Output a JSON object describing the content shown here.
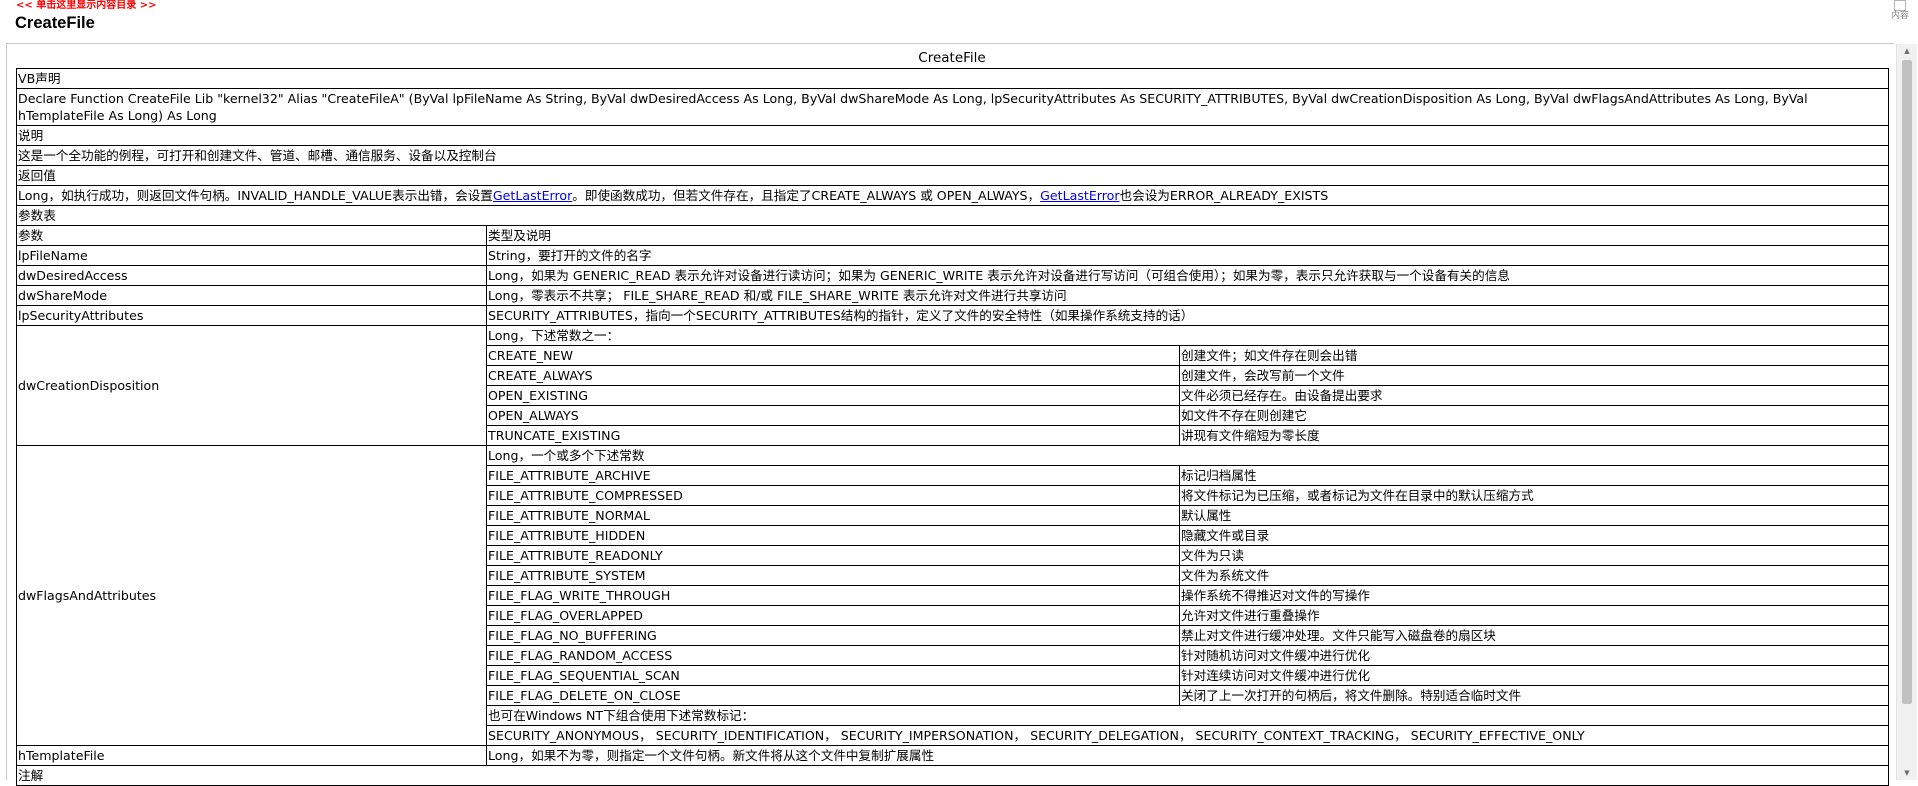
{
  "header": {
    "toc_link": "<< 单击这里显示内容目录 >>",
    "title": "CreateFile",
    "content_button": "内容"
  },
  "doc": {
    "title": "CreateFile",
    "vb_header": "VB声明",
    "vb_declare": "Declare Function CreateFile Lib \"kernel32\" Alias \"CreateFileA\" (ByVal lpFileName As String, ByVal dwDesiredAccess As Long, ByVal dwShareMode As Long, lpSecurityAttributes As SECURITY_ATTRIBUTES, ByVal dwCreationDisposition As Long, ByVal dwFlagsAndAttributes As Long, ByVal hTemplateFile As Long) As Long",
    "desc_header": "说明",
    "desc_text": "这是一个全功能的例程，可打开和创建文件、管道、邮槽、通信服务、设备以及控制台",
    "ret_header": "返回值",
    "ret_text_1": "Long，如执行成功，则返回文件句柄。INVALID_HANDLE_VALUE表示出错，会设置",
    "ret_link_1": "GetLastError",
    "ret_text_2": "。即使函数成功，但若文件存在，且指定了CREATE_ALWAYS 或 OPEN_ALWAYS，",
    "ret_link_2": "GetLastError",
    "ret_text_3": "也会设为ERROR_ALREADY_EXISTS",
    "params_header": "参数表",
    "col_param": "参数",
    "col_type": "类型及说明",
    "params": {
      "lpFileName": {
        "name": "lpFileName",
        "desc": "String，要打开的文件的名字"
      },
      "dwDesiredAccess": {
        "name": "dwDesiredAccess",
        "desc": "Long，如果为 GENERIC_READ 表示允许对设备进行读访问；如果为 GENERIC_WRITE 表示允许对设备进行写访问（可组合使用）；如果为零，表示只允许获取与一个设备有关的信息"
      },
      "dwShareMode": {
        "name": "dwShareMode",
        "desc": "Long，零表示不共享； FILE_SHARE_READ 和/或 FILE_SHARE_WRITE 表示允许对文件进行共享访问"
      },
      "lpSecurityAttributes": {
        "name": "lpSecurityAttributes",
        "desc": "SECURITY_ATTRIBUTES，指向一个SECURITY_ATTRIBUTES结构的指针，定义了文件的安全特性（如果操作系统支持的话）"
      },
      "dwCreationDisposition": {
        "name": "dwCreationDisposition",
        "intro": "Long，下述常数之一：",
        "consts": [
          [
            "CREATE_NEW",
            "创建文件；如文件存在则会出错"
          ],
          [
            "CREATE_ALWAYS",
            "创建文件，会改写前一个文件"
          ],
          [
            "OPEN_EXISTING",
            "文件必须已经存在。由设备提出要求"
          ],
          [
            "OPEN_ALWAYS",
            "如文件不存在则创建它"
          ],
          [
            "TRUNCATE_EXISTING",
            "讲现有文件缩短为零长度"
          ]
        ]
      },
      "dwFlagsAndAttributes": {
        "name": "dwFlagsAndAttributes",
        "intro": "Long，一个或多个下述常数",
        "consts": [
          [
            "FILE_ATTRIBUTE_ARCHIVE",
            "标记归档属性"
          ],
          [
            "FILE_ATTRIBUTE_COMPRESSED",
            "将文件标记为已压缩，或者标记为文件在目录中的默认压缩方式"
          ],
          [
            "FILE_ATTRIBUTE_NORMAL",
            "默认属性"
          ],
          [
            "FILE_ATTRIBUTE_HIDDEN",
            "隐藏文件或目录"
          ],
          [
            "FILE_ATTRIBUTE_READONLY",
            "文件为只读"
          ],
          [
            "FILE_ATTRIBUTE_SYSTEM",
            "文件为系统文件"
          ],
          [
            "FILE_FLAG_WRITE_THROUGH",
            "操作系统不得推迟对文件的写操作"
          ],
          [
            "FILE_FLAG_OVERLAPPED",
            "允许对文件进行重叠操作"
          ],
          [
            "FILE_FLAG_NO_BUFFERING",
            "禁止对文件进行缓冲处理。文件只能写入磁盘卷的扇区块"
          ],
          [
            "FILE_FLAG_RANDOM_ACCESS",
            "针对随机访问对文件缓冲进行优化"
          ],
          [
            "FILE_FLAG_SEQUENTIAL_SCAN",
            "针对连续访问对文件缓冲进行优化"
          ],
          [
            "FILE_FLAG_DELETE_ON_CLOSE",
            "关闭了上一次打开的句柄后，将文件删除。特别适合临时文件"
          ]
        ],
        "nt_note": "也可在Windows NT下组合使用下述常数标记：",
        "nt_consts": "SECURITY_ANONYMOUS， SECURITY_IDENTIFICATION， SECURITY_IMPERSONATION， SECURITY_DELEGATION， SECURITY_CONTEXT_TRACKING， SECURITY_EFFECTIVE_ONLY"
      },
      "hTemplateFile": {
        "name": "hTemplateFile",
        "desc": "Long，如果不为零，则指定一个文件句柄。新文件将从这个文件中复制扩展属性"
      }
    },
    "notes_header": "注解"
  },
  "icons": {
    "scroll_up": "scroll-up-arrow-icon",
    "scroll_down": "scroll-down-arrow-icon"
  }
}
